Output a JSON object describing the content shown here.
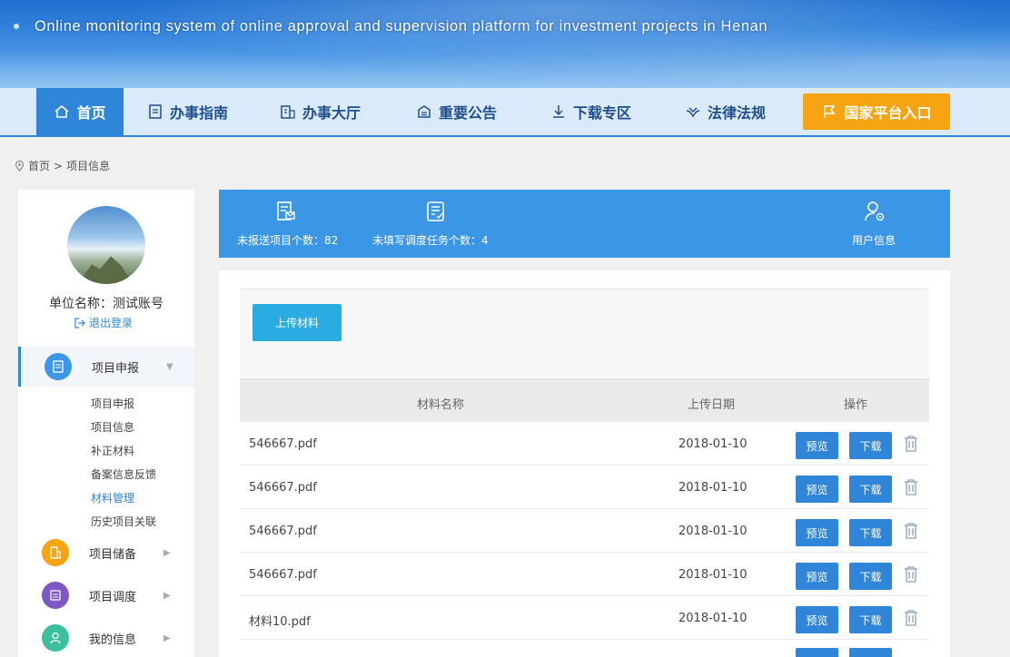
{
  "banner": {
    "subtitle": "Online monitoring system of online approval and supervision platform for investment projects in Henan"
  },
  "nav": {
    "items": [
      {
        "label": "首页",
        "icon": "home-icon"
      },
      {
        "label": "办事指南",
        "icon": "guide-icon"
      },
      {
        "label": "办事大厅",
        "icon": "hall-icon"
      },
      {
        "label": "重要公告",
        "icon": "notice-icon"
      },
      {
        "label": "下载专区",
        "icon": "download-icon"
      },
      {
        "label": "法律法规",
        "icon": "law-icon"
      },
      {
        "label": "国家平台入口",
        "icon": "flag-icon"
      }
    ]
  },
  "breadcrumb": {
    "home": "首页",
    "separator": ">",
    "current": "项目信息"
  },
  "sidebar": {
    "unit_name": "单位名称：测试账号",
    "logout": "退出登录",
    "groups": [
      {
        "label": "项目申报",
        "color": "#3b97e6",
        "arrow": "▼"
      },
      {
        "label": "项目储备",
        "color": "#f7a413",
        "arrow": "▶"
      },
      {
        "label": "项目调度",
        "color": "#7e57c2",
        "arrow": "▶"
      },
      {
        "label": "我的信息",
        "color": "#3bbf9c",
        "arrow": "▶"
      }
    ],
    "sub_items": [
      "项目申报",
      "项目信息",
      "补正材料",
      "备案信息反馈",
      "材料管理",
      "历史项目关联"
    ]
  },
  "stats": {
    "unreported": "未报送项目个数：82",
    "unfilled": "未填写调度任务个数：4",
    "user_info": "用户信息"
  },
  "content": {
    "upload_label": "上传材料",
    "columns": [
      "材料名称",
      "上传日期",
      "操作"
    ],
    "preview_label": "预览",
    "download_label": "下载",
    "rows": [
      {
        "name": "546667.pdf",
        "date": "2018-01-10"
      },
      {
        "name": "546667.pdf",
        "date": "2018-01-10"
      },
      {
        "name": "546667.pdf",
        "date": "2018-01-10"
      },
      {
        "name": "546667.pdf",
        "date": "2018-01-10"
      },
      {
        "name": "材料10.pdf",
        "date": "2018-01-10"
      }
    ]
  },
  "colors": {
    "primary": "#2f86d8",
    "accent": "#f7a413",
    "stats_bg": "#3b97e6",
    "upload": "#2aace2"
  }
}
